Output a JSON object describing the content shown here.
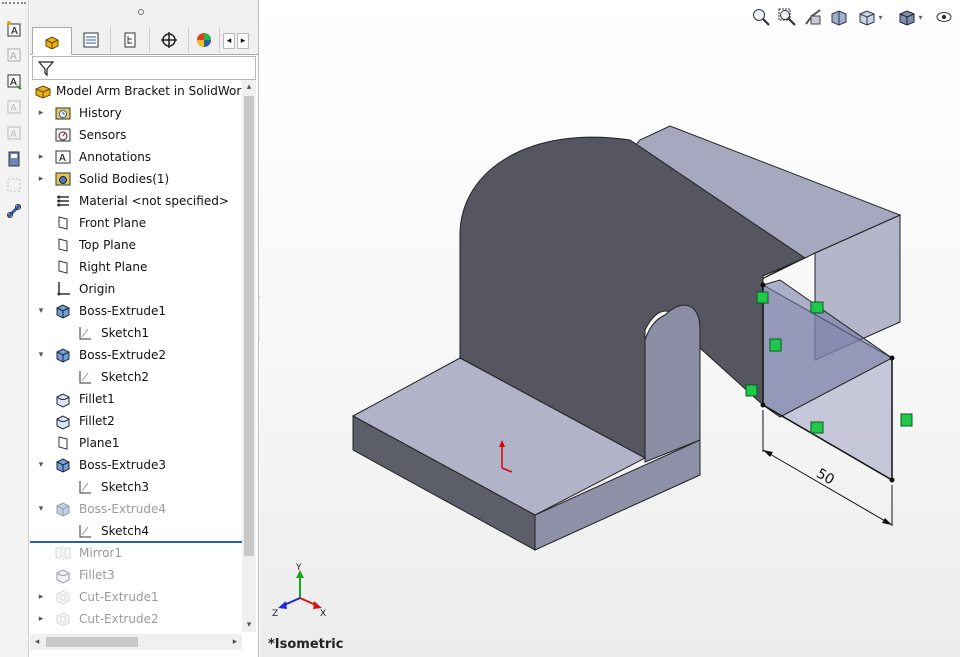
{
  "feature_manager": {
    "root_label": "Model Arm Bracket in SolidWorks",
    "items": [
      {
        "label": "History",
        "expand": "▸",
        "icon": "history-folder-icon"
      },
      {
        "label": "Sensors",
        "expand": "",
        "icon": "sensors-icon"
      },
      {
        "label": "Annotations",
        "expand": "▸",
        "icon": "annotations-icon"
      },
      {
        "label": "Solid Bodies(1)",
        "expand": "▸",
        "icon": "solid-bodies-icon"
      },
      {
        "label": "Material <not specified>",
        "expand": "",
        "icon": "material-icon"
      },
      {
        "label": "Front Plane",
        "expand": "",
        "icon": "plane-icon"
      },
      {
        "label": "Top Plane",
        "expand": "",
        "icon": "plane-icon"
      },
      {
        "label": "Right Plane",
        "expand": "",
        "icon": "plane-icon"
      },
      {
        "label": "Origin",
        "expand": "",
        "icon": "origin-icon"
      },
      {
        "label": "Boss-Extrude1",
        "expand": "▾",
        "icon": "boss-extrude-icon"
      },
      {
        "label": "Sketch1",
        "expand": "",
        "icon": "sketch-icon"
      },
      {
        "label": "Boss-Extrude2",
        "expand": "▾",
        "icon": "boss-extrude-icon"
      },
      {
        "label": "Sketch2",
        "expand": "",
        "icon": "sketch-icon"
      },
      {
        "label": "Fillet1",
        "expand": "",
        "icon": "fillet-icon"
      },
      {
        "label": "Fillet2",
        "expand": "",
        "icon": "fillet-icon"
      },
      {
        "label": "Plane1",
        "expand": "",
        "icon": "plane-icon"
      },
      {
        "label": "Boss-Extrude3",
        "expand": "▾",
        "icon": "boss-extrude-icon"
      },
      {
        "label": "Sketch3",
        "expand": "",
        "icon": "sketch-icon"
      },
      {
        "label": "Boss-Extrude4",
        "expand": "▾",
        "icon": "boss-extrude-icon",
        "suppressed": true
      },
      {
        "label": "Sketch4",
        "expand": "",
        "icon": "sketch-icon"
      },
      {
        "label": "Mirror1",
        "expand": "",
        "icon": "mirror-icon",
        "suppressed": true
      },
      {
        "label": "Fillet3",
        "expand": "",
        "icon": "fillet-icon",
        "suppressed": true
      },
      {
        "label": "Cut-Extrude1",
        "expand": "▸",
        "icon": "cut-extrude-icon",
        "suppressed": true
      },
      {
        "label": "Cut-Extrude2",
        "expand": "▸",
        "icon": "cut-extrude-icon",
        "suppressed": true
      }
    ]
  },
  "tabs": [
    "featuremanager-tab",
    "propertymanager-tab",
    "configurationmanager-tab",
    "dimxpertmanager-tab",
    "displaymanager-tab"
  ],
  "viewport": {
    "view_name": "*Isometric",
    "dimension_value": "50",
    "triad_labels": {
      "x": "X",
      "y": "Y",
      "z": "Z"
    }
  },
  "heads_up_toolbar": [
    "zoom-to-fit-icon",
    "zoom-to-area-icon",
    "previous-view-icon",
    "section-view-icon",
    "view-orientation-icon",
    "display-style-icon",
    "hide-show-items-icon"
  ],
  "colors": {
    "body_face": "#9a9cb4",
    "body_dark": "#55565f",
    "body_top": "#b1b3c8",
    "sketch_face": "#7b7fa6",
    "relation_green": "#1ec94a",
    "selection_blue": "#2b5fa8"
  }
}
